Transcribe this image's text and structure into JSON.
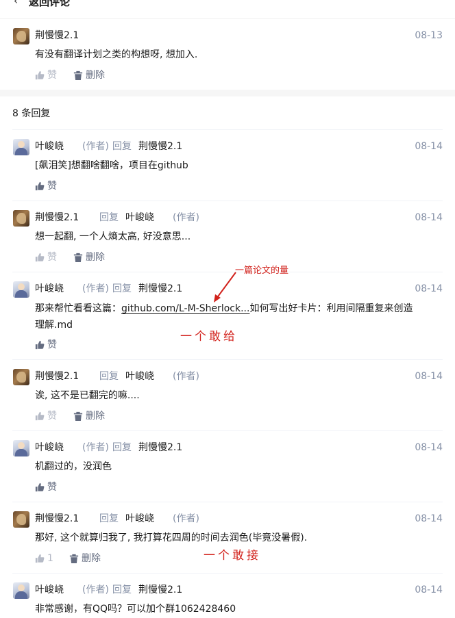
{
  "header": {
    "back_label": "返回评论"
  },
  "root_comment": {
    "author": "荆慢慢2.1",
    "date": "08-13",
    "text": "有没有翻译计划之类的构想呀, 想加入.",
    "like_label": "赞",
    "delete_label": "删除"
  },
  "replies_count_label": "8 条回复",
  "labels": {
    "author_tag": "(作者)",
    "reply": "回复",
    "like": "赞",
    "delete": "删除"
  },
  "replies": [
    {
      "author": "叶峻峣",
      "author_is_op": true,
      "target": "荆慢慢2.1",
      "date": "08-14",
      "text": "[飙泪笑]想翻啥翻啥，项目在github"
    },
    {
      "author": "荆慢慢2.1",
      "target": "叶峻峣",
      "target_is_op": true,
      "date": "08-14",
      "text": "想一起翻, 一个人熵太高, 好没意思..."
    },
    {
      "author": "叶峻峣",
      "author_is_op": true,
      "target": "荆慢慢2.1",
      "date": "08-14",
      "text_prefix": "那来帮忙看看这篇：",
      "link": "github.com/L-M-Sherlock...",
      "text_suffix": "如何写出好卡片：利用间隔重复来创造",
      "text_line2": "理解.md"
    },
    {
      "author": "荆慢慢2.1",
      "target": "叶峻峣",
      "target_is_op": true,
      "date": "08-14",
      "text": "诶, 这不是已翻完的嘛...."
    },
    {
      "author": "叶峻峣",
      "author_is_op": true,
      "target": "荆慢慢2.1",
      "date": "08-14",
      "text": "机翻过的，没润色"
    },
    {
      "author": "荆慢慢2.1",
      "target": "叶峻峣",
      "target_is_op": true,
      "date": "08-14",
      "text": "那好, 这个就算归我了, 我打算花四周的时间去润色(毕竟没暑假).",
      "like_count": "1"
    },
    {
      "author": "叶峻峣",
      "author_is_op": true,
      "target": "荆慢慢2.1",
      "date": "08-14",
      "text": "非常感谢，有QQ吗？可以加个群1062428460"
    }
  ],
  "annotations": {
    "note_small": "一篇论文的量",
    "note_give": "一个敢给",
    "note_take": "一个敢接",
    "color": "#d2221c"
  },
  "colors": {
    "meta_gray": "#8590a6",
    "text": "#1a1a1a",
    "divider": "#f0f2f7"
  },
  "icons": [
    "chevron-left-icon",
    "thumbs-up-icon",
    "trash-icon",
    "arrow-icon"
  ]
}
